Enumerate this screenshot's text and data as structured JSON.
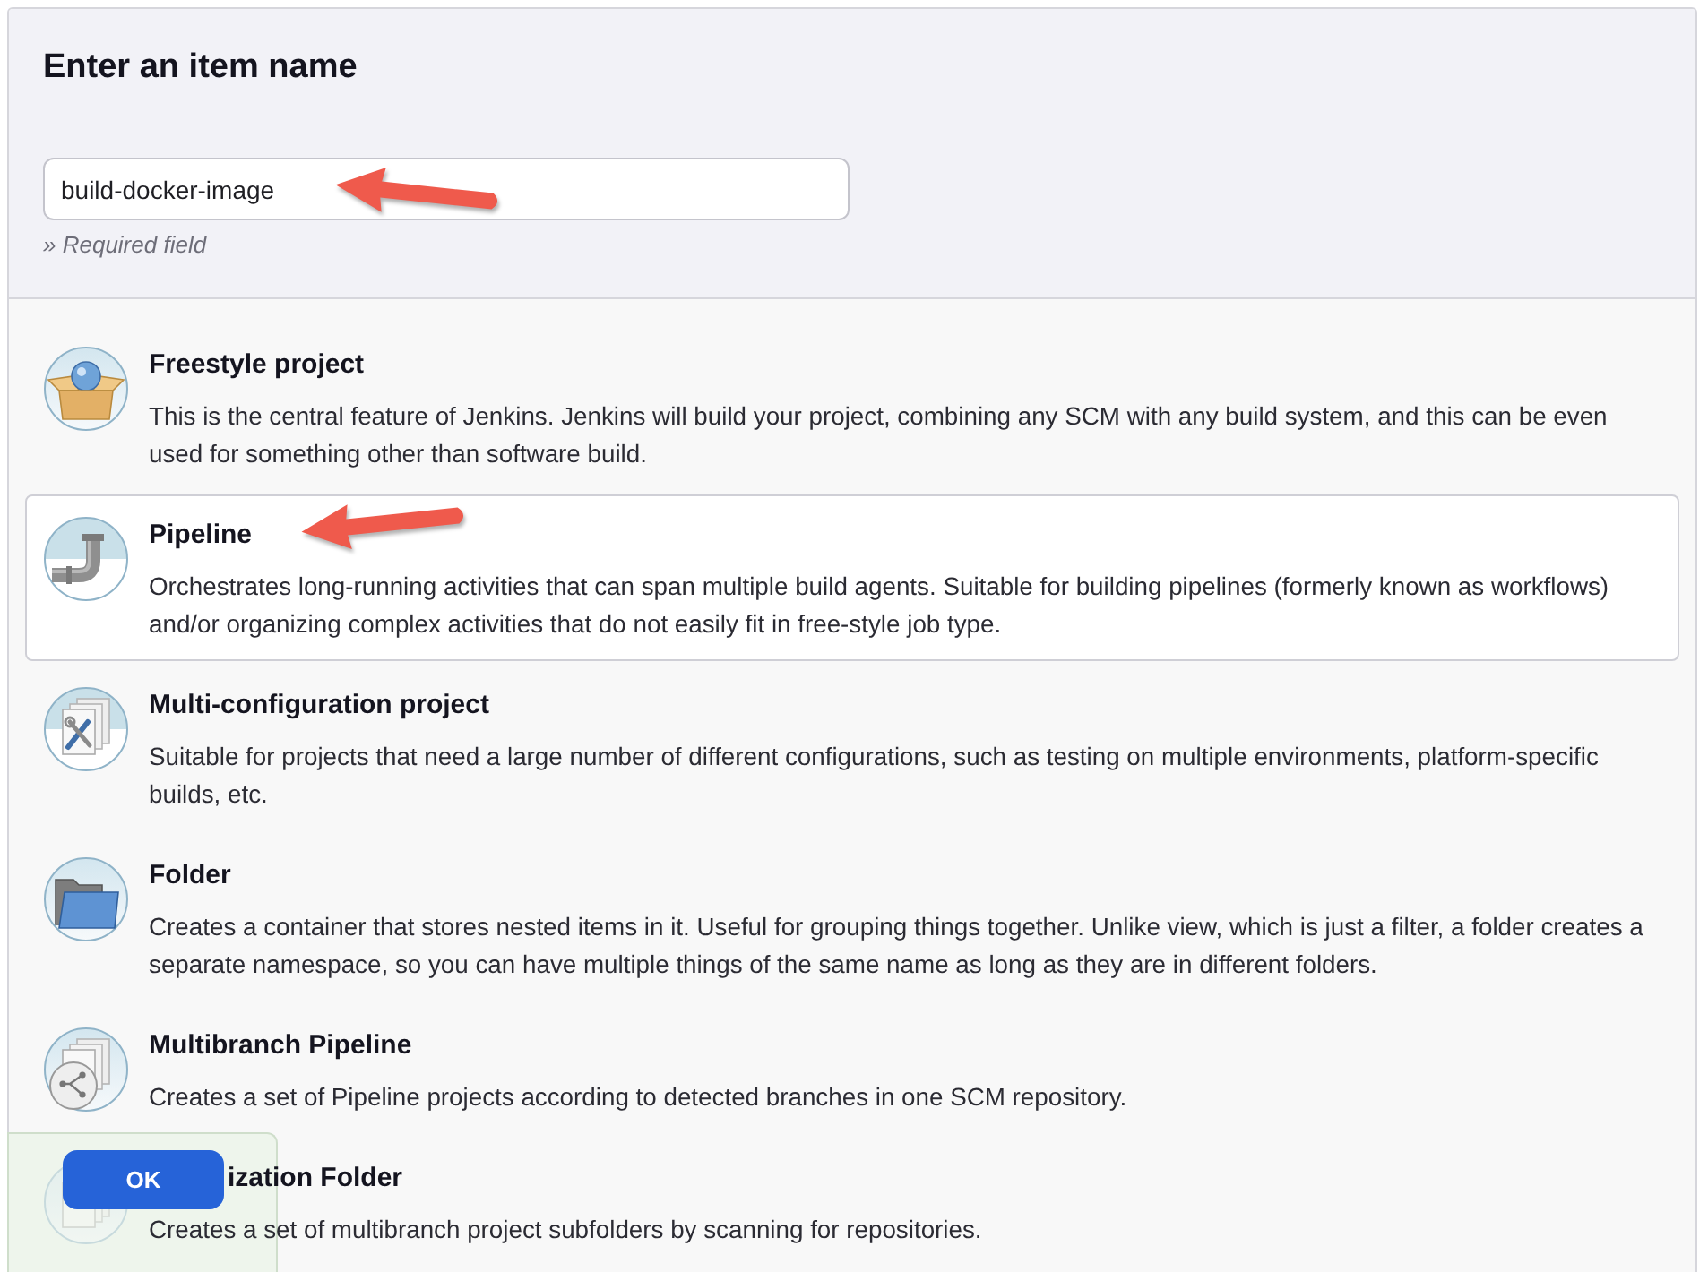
{
  "form": {
    "heading": "Enter an item name",
    "name_field": {
      "value": "build-docker-image",
      "arrow": true
    },
    "hint": "» Required field"
  },
  "item_types": [
    {
      "kind": "freestyle",
      "title": "Freestyle project",
      "description": "This is the central feature of Jenkins. Jenkins will build your project, combining any SCM with any build system, and this can be even used for something other than software build.",
      "selected": false,
      "arrow": false,
      "obscured": false
    },
    {
      "kind": "pipeline",
      "title": "Pipeline",
      "description": "Orchestrates long-running activities that can span multiple build agents. Suitable for building pipelines (formerly known as workflows) and/or organizing complex activities that do not easily fit in free-style job type.",
      "selected": true,
      "arrow": true,
      "obscured": false
    },
    {
      "kind": "matrix",
      "title": "Multi-configuration project",
      "description": "Suitable for projects that need a large number of different configurations, such as testing on multiple environments, platform-specific builds, etc.",
      "selected": false,
      "arrow": false,
      "obscured": false
    },
    {
      "kind": "folder",
      "title": "Folder",
      "description": "Creates a container that stores nested items in it. Useful for grouping things together. Unlike view, which is just a filter, a folder creates a separate namespace, so you can have multiple things of the same name as long as they are in different folders.",
      "selected": false,
      "arrow": false,
      "obscured": false
    },
    {
      "kind": "multibranch",
      "title": "Multibranch Pipeline",
      "description": "Creates a set of Pipeline projects according to detected branches in one SCM repository.",
      "selected": false,
      "arrow": false,
      "obscured": false
    },
    {
      "kind": "organization",
      "title": "ization Folder",
      "description": "Creates a set of multibranch project subfolders by scanning for repositories.",
      "selected": false,
      "arrow": false,
      "obscured": true
    }
  ],
  "footer": {
    "button": "OK"
  }
}
